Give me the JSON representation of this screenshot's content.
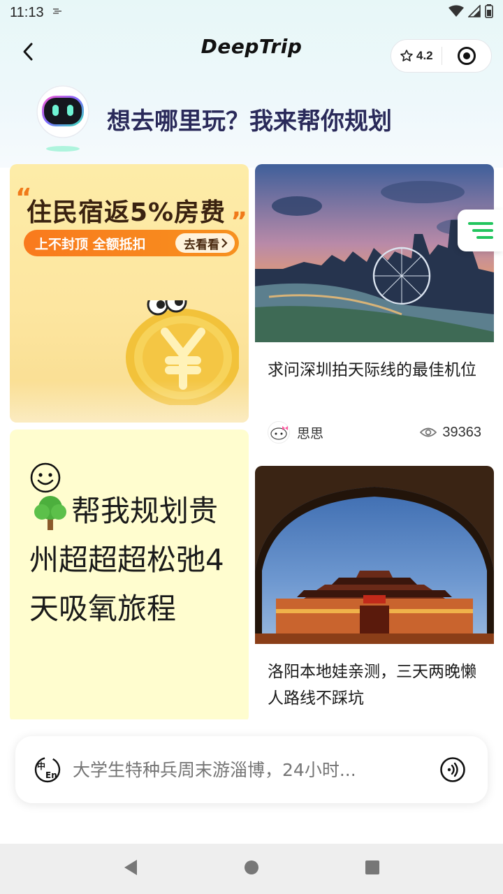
{
  "status_bar": {
    "time": "11:13"
  },
  "header": {
    "title": "DeepTrip",
    "rating": "4.2"
  },
  "greeting": {
    "text": "想去哪里玩？我来帮你规划"
  },
  "promo_card": {
    "headline": "住民宿返5%房费",
    "subline": "上不封顶 全额抵扣",
    "button_label": "去看看"
  },
  "ai_prompt_card": {
    "text": "帮我规划贵州超超超松弛4天吸氧旅程"
  },
  "feed": [
    {
      "title": "求问深圳拍天际线的最佳机位",
      "author": "思思",
      "views": "39363"
    },
    {
      "title": "洛阳本地娃亲测，三天两晚懒人路线不踩坑"
    }
  ],
  "input": {
    "placeholder": "大学生特种兵周末游淄博，24小时...",
    "lang_icon_text": "中En"
  },
  "colors": {
    "accent_green": "#22c55e",
    "promo_orange": "#f97a1d",
    "title_navy": "#2a2a5a"
  }
}
